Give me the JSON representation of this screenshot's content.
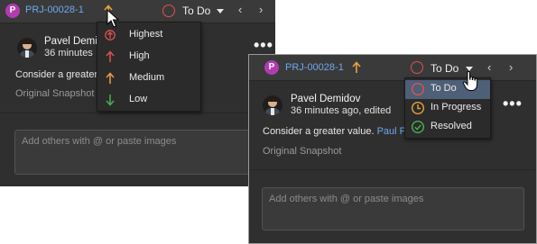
{
  "back_panel": {
    "badge": "P",
    "issue_id": "PRJ-00028-1",
    "status": "To Do",
    "prev": "‹",
    "next": "›",
    "author": "Pavel Demidov",
    "time": "36 minutes",
    "comment": "Consider a greater",
    "snapshot": "Original Snapshot",
    "more": "•••",
    "input_placeholder": "Add others with @ or paste images"
  },
  "priority_menu": {
    "items": [
      {
        "label": "Highest",
        "icon": "priority-highest-icon",
        "color": "#e05050"
      },
      {
        "label": "High",
        "icon": "arrow-up-icon",
        "color": "#e05050"
      },
      {
        "label": "Medium",
        "icon": "arrow-up-icon",
        "color": "#e8a33c"
      },
      {
        "label": "Low",
        "icon": "arrow-down-icon",
        "color": "#49b050"
      }
    ]
  },
  "front_panel": {
    "badge": "P",
    "issue_id": "PRJ-00028-1",
    "status": "To Do",
    "prev": "‹",
    "next": "›",
    "author": "Pavel Demidov",
    "time": "36 minutes ago, edited",
    "comment": "Consider a greater value.",
    "mention": "Paul Pa",
    "snapshot": "Original Snapshot",
    "more": "•••",
    "input_placeholder": "Add others with @ or paste images"
  },
  "status_menu": {
    "items": [
      {
        "label": "To Do",
        "icon": "todo-circle-icon",
        "color": "#e05050",
        "selected": true
      },
      {
        "label": "In Progress",
        "icon": "clock-icon",
        "color": "#e8a33c",
        "selected": false
      },
      {
        "label": "Resolved",
        "icon": "check-circle-icon",
        "color": "#49b050",
        "selected": false
      }
    ]
  },
  "colors": {
    "panel_bg": "#2f2f2f",
    "header_bg": "#3a3a3a",
    "link": "#6fa8ee",
    "priority_medium": "#e8a33c",
    "badge": "#b23bb0",
    "selected_bg": "#4e5f78"
  }
}
